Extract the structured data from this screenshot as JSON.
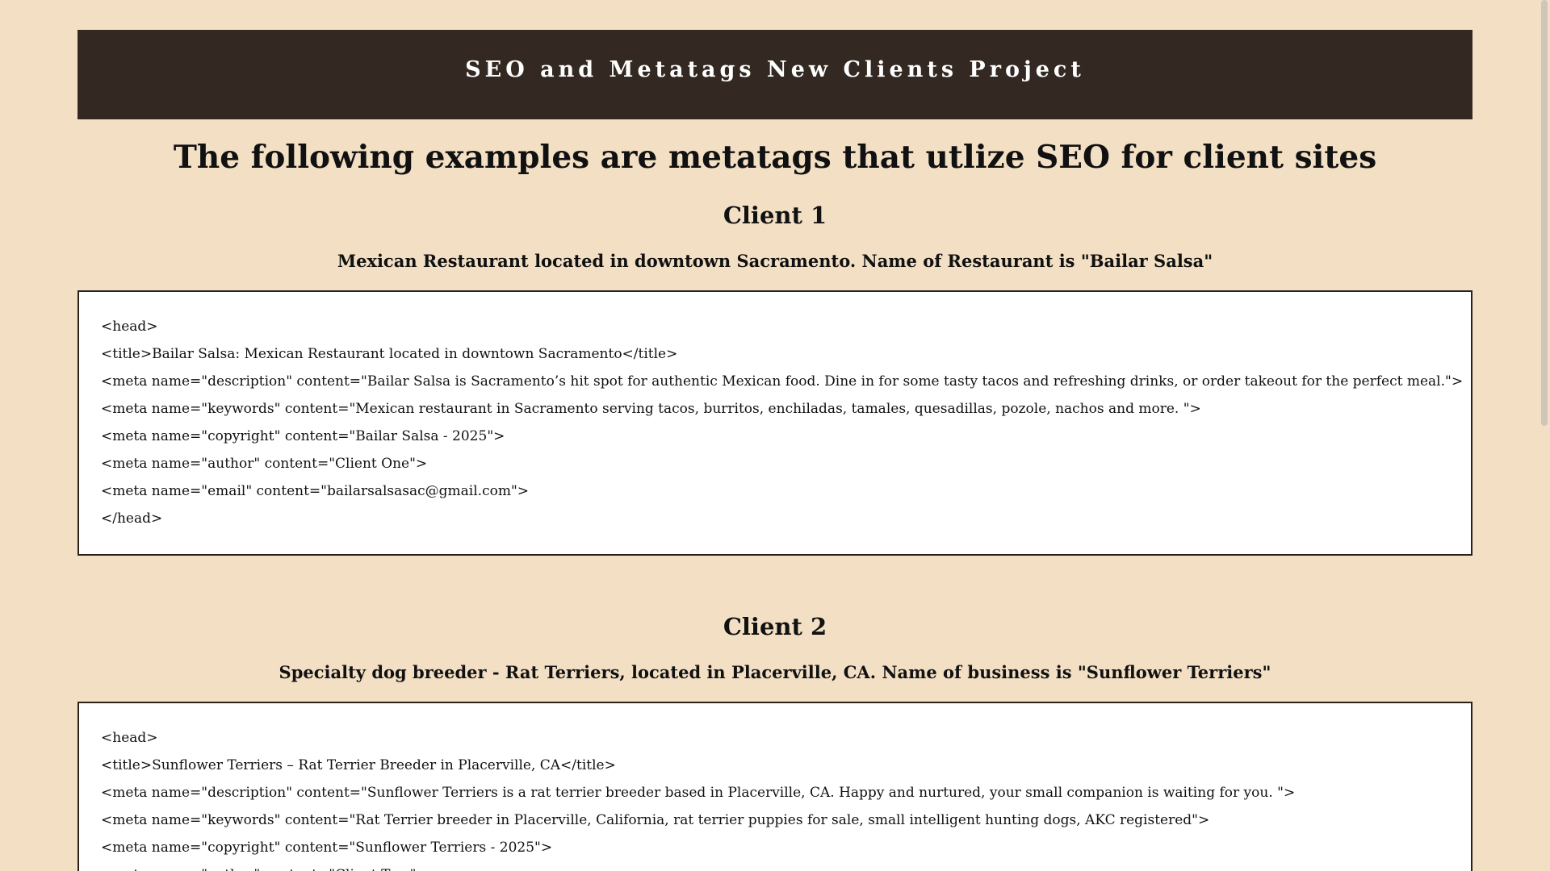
{
  "banner": {
    "title": "SEO and Metatags New Clients Project"
  },
  "main_heading": "The following examples are metatags that utlize SEO for client sites",
  "clients": [
    {
      "heading": "Client 1",
      "description": "Mexican Restaurant located in downtown Sacramento. Name of Restaurant is \"Bailar Salsa\"",
      "code_lines": [
        "<head>",
        "<title>Bailar Salsa: Mexican Restaurant located in downtown Sacramento</title>",
        "<meta name=\"description\" content=\"Bailar Salsa is Sacramento’s hit spot for authentic Mexican food. Dine in for some tasty tacos and refreshing drinks, or order takeout for the perfect meal.\">",
        "<meta name=\"keywords\" content=\"Mexican restaurant in Sacramento serving tacos, burritos, enchiladas, tamales, quesadillas, pozole, nachos and more. \">",
        "<meta name=\"copyright\" content=\"Bailar Salsa - 2025\">",
        "<meta name=\"author\" content=\"Client One\">",
        "<meta name=\"email\" content=\"bailarsalsasac@gmail.com\">",
        "</head>"
      ]
    },
    {
      "heading": "Client 2",
      "description": "Specialty dog breeder - Rat Terriers, located in Placerville, CA. Name of business is \"Sunflower Terriers\"",
      "code_lines": [
        "<head>",
        "<title>Sunflower Terriers – Rat Terrier Breeder in Placerville, CA</title>",
        "<meta name=\"description\" content=\"Sunflower Terriers is a rat terrier breeder based in Placerville, CA. Happy and nurtured, your small companion is waiting for you. \">",
        "<meta name=\"keywords\" content=\"Rat Terrier breeder in Placerville, California, rat terrier puppies for sale, small intelligent hunting dogs, AKC registered\">",
        "<meta name=\"copyright\" content=\"Sunflower Terriers - 2025\">",
        "<meta name=\"author\" content=\"Client Two\">"
      ]
    }
  ]
}
